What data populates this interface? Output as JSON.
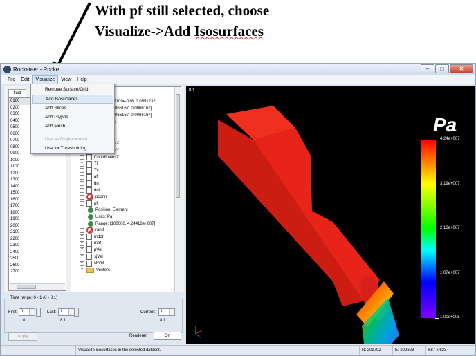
{
  "caption": {
    "line1": "With pf still selected, choose",
    "line2_prefix": "Visualize->Add ",
    "line2_squiggle": "Isosurfaces"
  },
  "window": {
    "title": "Rocketeer - Rocke"
  },
  "menubar": [
    "File",
    "Edit",
    "Visualize",
    "View",
    "Help"
  ],
  "visualize_menu": {
    "items": [
      {
        "label": "Remove Surface/Grid",
        "enabled": true
      },
      {
        "label": "Add Isosurfaces",
        "enabled": true,
        "highlighted": true
      },
      {
        "label": "Add Slices",
        "enabled": true
      },
      {
        "label": "Add Glyphs",
        "enabled": true
      },
      {
        "label": "Add Mesh",
        "enabled": true
      },
      {
        "label": "Use as Displacement",
        "enabled": false
      },
      {
        "label": "Use for Thresholding",
        "enabled": true
      }
    ]
  },
  "left_panel": {
    "tab": "fluid",
    "time_steps": [
      "0100",
      "0200",
      "0300",
      "0400",
      "0500",
      "0600",
      "0700",
      "0800",
      "0900",
      "1000",
      "1100",
      "1200",
      "1300",
      "1400",
      "1500",
      "1600",
      "1700",
      "1800",
      "1900",
      "2000",
      "2100",
      "2200",
      "2300",
      "2400",
      "2500",
      "2600",
      "2700"
    ],
    "selected_step": "0100"
  },
  "tree": {
    "partial_rows": [
      "52109e-018, 0.0551232]",
      ".0066167, 0.0066167]",
      ".0066167, 0.0066167]",
      "cs"
    ],
    "rows": [
      {
        "label": "2edges",
        "icon": "ban",
        "expander": "+"
      },
      {
        "label": "CoordinatesX",
        "icon": "doc",
        "expander": "+"
      },
      {
        "label": "CoordinatesY",
        "icon": "doc",
        "expander": "+"
      },
      {
        "label": "CoordinatesZ",
        "icon": "doc",
        "expander": "+"
      },
      {
        "label": "Tf",
        "icon": "doc",
        "expander": "+"
      },
      {
        "label": "Tv",
        "icon": "doc",
        "expander": "+"
      },
      {
        "label": "af",
        "icon": "doc",
        "expander": "+"
      },
      {
        "label": "dn",
        "icon": "doc",
        "expander": "+"
      },
      {
        "label": "ddf",
        "icon": "doc",
        "expander": "+"
      },
      {
        "label": "pconn",
        "icon": "ban",
        "expander": "+"
      },
      {
        "label": "pf",
        "icon": "doc",
        "expander": "-"
      },
      {
        "label": "Position: Element",
        "icon": "gear",
        "expander": "",
        "indent": 1
      },
      {
        "label": "Units: Pa",
        "icon": "gear",
        "expander": "",
        "indent": 1
      },
      {
        "label": "Range: [100000, 4.24418e+007]",
        "icon": "gear",
        "expander": "",
        "indent": 1
      },
      {
        "label": "rand",
        "icon": "ban",
        "expander": "+"
      },
      {
        "label": "mdot",
        "icon": "doc",
        "expander": "+"
      },
      {
        "label": "mof",
        "icon": "doc",
        "expander": "+"
      },
      {
        "label": "pVel",
        "icon": "doc",
        "expander": "+"
      },
      {
        "label": "sjVel",
        "icon": "doc",
        "expander": "+"
      },
      {
        "label": "skVel",
        "icon": "doc",
        "expander": "+"
      },
      {
        "label": "Vectors",
        "icon": "folder",
        "expander": "+"
      }
    ]
  },
  "time_range": {
    "legend": "Time range: 0 - 1 (0 - 8.1)",
    "first_label": "First:",
    "first_value": "0",
    "first_display": "0",
    "last_label": "Last:",
    "last_value": "1",
    "last_display": "8.1",
    "current_label": "Current:",
    "current_value": "1",
    "current_display": "8.1"
  },
  "apply_label": "Apply",
  "renderer": {
    "label": "Renderer:",
    "value": "On"
  },
  "viewport": {
    "label": "8.1",
    "colorbar": {
      "title": "Pa",
      "labels": [
        "4.24e+007",
        "3.19e+007",
        "2.13e+007",
        "1.07e+007",
        "1.00e+005"
      ]
    }
  },
  "statusbar": {
    "message": "Visualize isosurfaces in the selected dataset.",
    "n": "N: 209792",
    "e": "E: 202623",
    "size": "687 x 623"
  },
  "colors": {
    "geometry_red": "#e8241a",
    "menu_highlight": "#dde8f5",
    "window_frame": "#dfe7f1"
  }
}
